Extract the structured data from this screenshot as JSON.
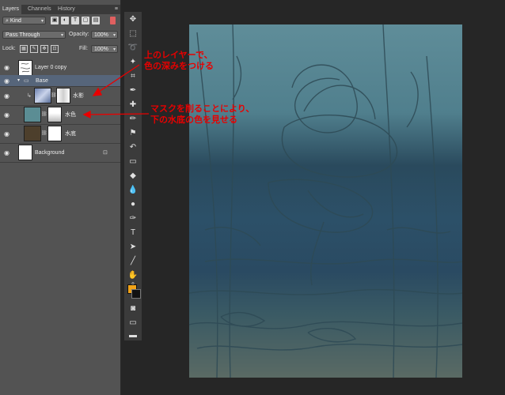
{
  "panel": {
    "tabs": [
      "Layers",
      "Channels",
      "History"
    ],
    "menu_icon": "≡",
    "filter": {
      "kind_label": "Kind",
      "icons": [
        "image-filter-icon",
        "adjustment-filter-icon",
        "type-filter-icon",
        "shape-filter-icon",
        "smart-object-filter-icon"
      ]
    },
    "blend_mode": "Pass Through",
    "opacity_label": "Opacity:",
    "opacity_value": "100%",
    "lock_label": "Lock:",
    "fill_label": "Fill:",
    "fill_value": "100%"
  },
  "layers": [
    {
      "name": "Layer 0 copy",
      "thumb": "sketch"
    },
    {
      "name": "Base",
      "type": "group",
      "selected": true
    },
    {
      "name": "水影",
      "thumb": "gradient-blue",
      "mask": true,
      "clipped": true
    },
    {
      "name": "水色",
      "thumb": "teal",
      "mask": true
    },
    {
      "name": "水底",
      "thumb": "brown",
      "mask": true
    },
    {
      "name": "Background",
      "thumb": "white",
      "locked": true
    }
  ],
  "annotations": {
    "top": [
      "上のレイヤーで、",
      "色の深みをつける"
    ],
    "bottom": [
      "マスクを削ることにより、",
      "下の水底の色を見せる"
    ]
  },
  "colors": {
    "accent": "#e80000",
    "foreground": "#f2a318",
    "background_swatch": "#111111"
  }
}
